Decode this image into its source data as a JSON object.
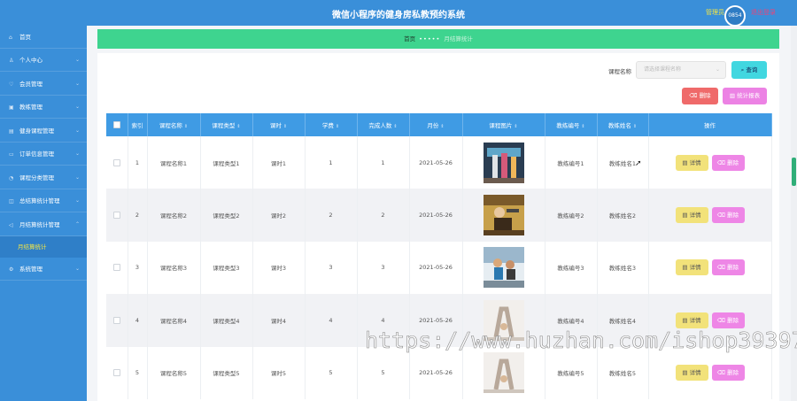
{
  "header": {
    "title": "微信小程序的健身房私教预约系统",
    "admin_label": "管理员",
    "avatar_text": "0854",
    "logout_label": "退出登录"
  },
  "sidebar": {
    "items": [
      {
        "label": "首页",
        "icon": "home-icon",
        "has_arrow": false
      },
      {
        "label": "个人中心",
        "icon": "user-icon",
        "has_arrow": true
      },
      {
        "label": "会员管理",
        "icon": "member-icon",
        "has_arrow": true
      },
      {
        "label": "教练管理",
        "icon": "coach-icon",
        "has_arrow": true
      },
      {
        "label": "健身课程管理",
        "icon": "course-icon",
        "has_arrow": true
      },
      {
        "label": "订单信息管理",
        "icon": "order-icon",
        "has_arrow": true
      },
      {
        "label": "课程分类管理",
        "icon": "category-icon",
        "has_arrow": true
      },
      {
        "label": "总结算统计管理",
        "icon": "stats-icon",
        "has_arrow": true
      },
      {
        "label": "月结算统计管理",
        "icon": "monthly-icon",
        "has_arrow": true
      }
    ],
    "sub_item": "月结算统计",
    "last_item": {
      "label": "系统管理",
      "icon": "system-icon",
      "has_arrow": true
    }
  },
  "breadcrumb": {
    "home": "首页",
    "separator": "•••••",
    "current": "月结算统计"
  },
  "search": {
    "label": "课程名称",
    "placeholder": "请选择课程名称",
    "button_label": "查询"
  },
  "toolbar": {
    "delete_label": "删除",
    "stats_label": "统计报表"
  },
  "table": {
    "columns": [
      "索引",
      "课程名称",
      "课程类型",
      "课时",
      "学费",
      "完成人数",
      "月份",
      "课程图片",
      "教练编号",
      "教练姓名",
      "操作"
    ],
    "rows": [
      {
        "index": "1",
        "name": "课程名称1",
        "type": "课程类型1",
        "hours": "课时1",
        "fee": "1",
        "completed": "1",
        "month": "2021-05-26",
        "coach_no": "教练编号1",
        "coach_name": "教练姓名1"
      },
      {
        "index": "2",
        "name": "课程名称2",
        "type": "课程类型2",
        "hours": "课时2",
        "fee": "2",
        "completed": "2",
        "month": "2021-05-26",
        "coach_no": "教练编号2",
        "coach_name": "教练姓名2"
      },
      {
        "index": "3",
        "name": "课程名称3",
        "type": "课程类型3",
        "hours": "课时3",
        "fee": "3",
        "completed": "3",
        "month": "2021-05-26",
        "coach_no": "教练编号3",
        "coach_name": "教练姓名3"
      },
      {
        "index": "4",
        "name": "课程名称4",
        "type": "课程类型4",
        "hours": "课时4",
        "fee": "4",
        "completed": "4",
        "month": "2021-05-26",
        "coach_no": "教练编号4",
        "coach_name": "教练姓名4"
      },
      {
        "index": "5",
        "name": "课程名称5",
        "type": "课程类型5",
        "hours": "课时5",
        "fee": "5",
        "completed": "5",
        "month": "2021-05-26",
        "coach_no": "教练编号5",
        "coach_name": "教练姓名5"
      }
    ],
    "detail_label": "详情",
    "delete_label": "删除"
  },
  "watermark": "https://www.huzhan.com/ishop39397",
  "colors": {
    "primary": "#3a8fd9",
    "breadcrumb": "#3ed48f",
    "header_row": "#3f9be4",
    "detail": "#f2e27a",
    "delete": "#ee86e6",
    "search": "#41d7e0",
    "batch_delete": "#ef6a6a",
    "admin_text": "#f5e642",
    "logout_text": "#e8457a"
  }
}
